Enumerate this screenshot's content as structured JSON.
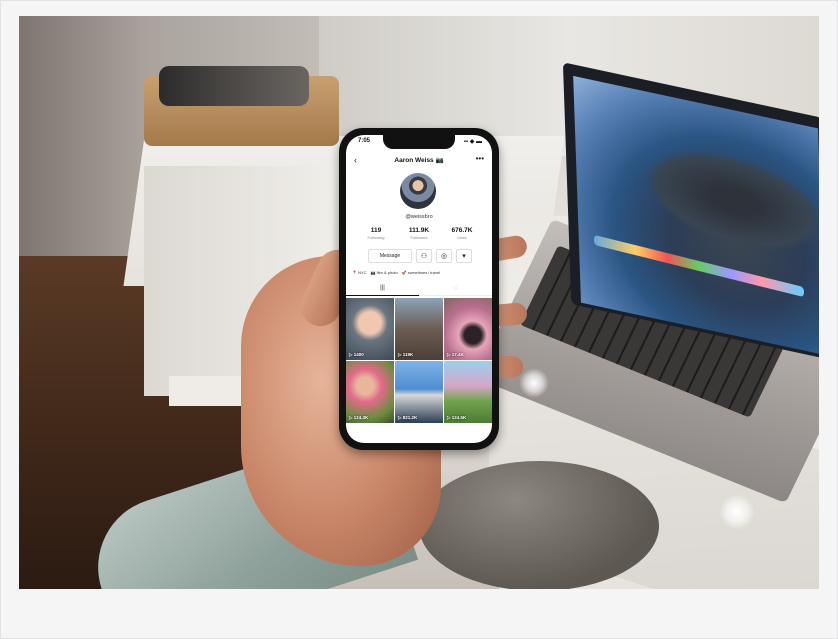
{
  "photo": {
    "subject": "hand-holding-phone"
  },
  "phone": {
    "status_time": "7:05",
    "status_icons": "▪▪ ◆ ▬",
    "back_icon": "‹",
    "username": "Aaron Weiss 📷",
    "more_icon": "•••",
    "handle": "@weissbro",
    "stats": [
      {
        "number": "119",
        "label": "Following"
      },
      {
        "number": "111.9K",
        "label": "Followers"
      },
      {
        "number": "676.7K",
        "label": "Likes"
      }
    ],
    "message_label": "Message",
    "follow_icon": "⚇",
    "instagram_icon": "◎",
    "dropdown_icon": "▾",
    "bio": [
      "📍 NYC",
      "📷 film & photo",
      "🚀 sometimes i travel"
    ],
    "tabs": [
      {
        "label": "|||",
        "icon": "videos-grid-icon"
      },
      {
        "label": "♡",
        "icon": "liked-icon"
      }
    ],
    "videos": [
      {
        "views": "▷ 1400"
      },
      {
        "views": "▷ 119K"
      },
      {
        "views": "▷ 17.4K"
      },
      {
        "views": "▷ 124.3K"
      },
      {
        "views": "▷ 821.2K"
      },
      {
        "views": "▷ 124.5K"
      }
    ]
  }
}
